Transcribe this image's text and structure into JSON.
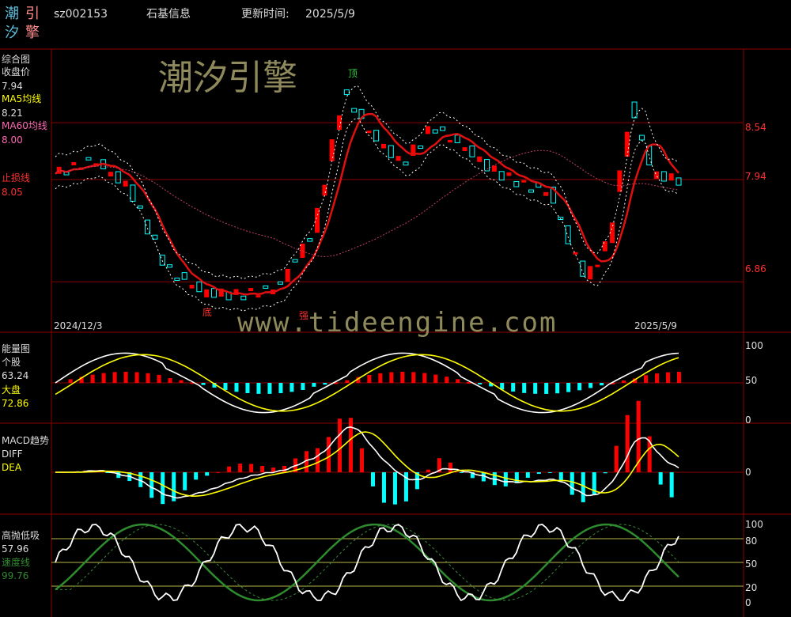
{
  "header": {
    "logo_chars": [
      "潮",
      "引",
      "汐",
      "擎"
    ],
    "code": "sz002153",
    "name": "石基信息",
    "update_label": "更新时间:",
    "update_date": "2025/5/9"
  },
  "watermark": {
    "brand": "潮汐引擎",
    "url": "www.tideengine.com"
  },
  "main_panel": {
    "title": "综合图",
    "close_label": "收盘价",
    "close_value": "7.94",
    "ma5_label": "MA5均线",
    "ma5_value": "8.21",
    "ma60_label": "MA60均线",
    "ma60_value": "8.00",
    "stop_label": "止损线",
    "stop_value": "8.05",
    "right_ticks": [
      "8.54",
      "7.94",
      "6.86"
    ],
    "start_date": "2024/12/3",
    "end_date": "2025/5/9",
    "marks": {
      "top": "顶",
      "bottom": "底",
      "strong": "强"
    }
  },
  "energy_panel": {
    "title": "能量图",
    "stock_label": "个股",
    "stock_value": "63.24",
    "market_label": "大盘",
    "market_value": "72.86",
    "ticks": [
      "100",
      "50",
      "0"
    ]
  },
  "macd_panel": {
    "title": "MACD趋势",
    "diff_label": "DIFF",
    "dea_label": "DEA",
    "ticks": [
      "0"
    ]
  },
  "osc_panel": {
    "title": "高抛低吸",
    "value": "57.96",
    "speed_label": "速度线",
    "speed_value": "99.76",
    "ticks": [
      "100",
      "80",
      "50",
      "20",
      "0"
    ]
  },
  "colors": {
    "up": "#ff0000",
    "down": "#00ffff",
    "grid": "#8b0000",
    "white": "#ffffff",
    "yellow": "#ffff00",
    "green": "#2e8b2e",
    "pink": "#ff69b4"
  },
  "chart_data": {
    "type": "candlestick",
    "date_range": [
      "2024/12/3",
      "2025/5/9"
    ],
    "price_ticks": [
      8.54,
      7.94,
      6.86
    ],
    "close_points": [
      {
        "i": 0,
        "c": 8.0
      },
      {
        "i": 10,
        "c": 8.15
      },
      {
        "i": 20,
        "c": 7.85
      },
      {
        "i": 30,
        "c": 7.0
      },
      {
        "i": 40,
        "c": 6.75
      },
      {
        "i": 50,
        "c": 6.72
      },
      {
        "i": 60,
        "c": 6.8
      },
      {
        "i": 70,
        "c": 7.4
      },
      {
        "i": 78,
        "c": 8.85
      },
      {
        "i": 86,
        "c": 8.4
      },
      {
        "i": 94,
        "c": 8.1
      },
      {
        "i": 102,
        "c": 8.5
      },
      {
        "i": 110,
        "c": 8.3
      },
      {
        "i": 118,
        "c": 8.05
      },
      {
        "i": 126,
        "c": 7.9
      },
      {
        "i": 134,
        "c": 7.8
      },
      {
        "i": 140,
        "c": 7.2
      },
      {
        "i": 144,
        "c": 6.9
      },
      {
        "i": 150,
        "c": 7.3
      },
      {
        "i": 156,
        "c": 8.7
      },
      {
        "i": 162,
        "c": 8.0
      },
      {
        "i": 168,
        "c": 7.94
      }
    ],
    "energy_ticks": [
      100,
      50,
      0
    ],
    "energy_last": {
      "stock": 63.24,
      "market": 72.86
    },
    "osc_ticks": [
      100,
      80,
      50,
      20,
      0
    ],
    "osc_last": {
      "value": 57.96,
      "speed": 99.76
    }
  }
}
